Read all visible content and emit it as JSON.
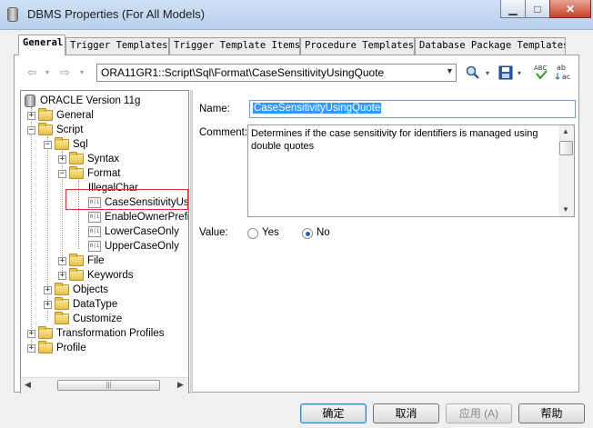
{
  "window": {
    "title": "DBMS Properties (For All Models)"
  },
  "tabs": [
    {
      "label": "General",
      "active": true
    },
    {
      "label": "Trigger Templates"
    },
    {
      "label": "Trigger Template Items"
    },
    {
      "label": "Procedure Templates"
    },
    {
      "label": "Database Package Templates"
    }
  ],
  "toolbar": {
    "path": "ORA11GR1::Script\\Sql\\Format\\CaseSensitivityUsingQuote",
    "find_icon": "find-icon",
    "save_icon": "save-icon",
    "spell_check_icon": "spell-check-icon",
    "sort_icon": "sort-icon"
  },
  "tree": {
    "root": "ORACLE Version 11g",
    "items": [
      {
        "label": "General"
      },
      {
        "label": "Script"
      },
      {
        "label": "Sql"
      },
      {
        "label": "Syntax"
      },
      {
        "label": "Format"
      },
      {
        "label": "IllegalChar"
      },
      {
        "label": "CaseSensitivityUsi"
      },
      {
        "label": "EnableOwnerPrefi"
      },
      {
        "label": "LowerCaseOnly"
      },
      {
        "label": "UpperCaseOnly"
      },
      {
        "label": "File"
      },
      {
        "label": "Keywords"
      },
      {
        "label": "Objects"
      },
      {
        "label": "DataType"
      },
      {
        "label": "Customize"
      },
      {
        "label": "Transformation Profiles"
      },
      {
        "label": "Profile"
      }
    ]
  },
  "form": {
    "name_label": "Name:",
    "name_value": "CaseSensitivityUsingQuote",
    "comment_label": "Comment:",
    "comment_value": "Determines if the case sensitivity for identifiers is managed using double quotes",
    "value_label": "Value:",
    "options": [
      {
        "label": "Yes",
        "checked": false
      },
      {
        "label": "No",
        "checked": true
      }
    ]
  },
  "buttons": {
    "ok": "确定",
    "cancel": "取消",
    "apply": "应用 (A)",
    "help": "帮助"
  }
}
